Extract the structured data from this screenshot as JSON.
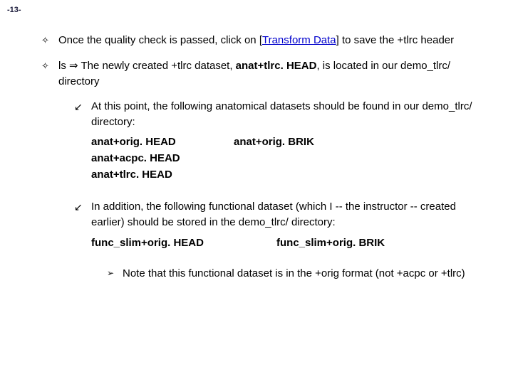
{
  "page_number": "-13-",
  "bullet1": {
    "pre": "Once the quality check is passed, click on ",
    "link": "Transform Data",
    "post": " to save the +tlrc header"
  },
  "bullet2": {
    "pre": "ls ",
    "arrow": "⇒",
    "mid": " The newly created +tlrc dataset, ",
    "bold": "anat+tlrc. HEAD",
    "post": ", is located in our demo_tlrc/ directory"
  },
  "sub1": "At this point, the following anatomical datasets should be found in our demo_tlrc/ directory:",
  "files": {
    "r1c1": "anat+orig. HEAD",
    "r1c2": "anat+orig. BRIK",
    "r2c1": "anat+acpc. HEAD",
    "r3c1": "anat+tlrc. HEAD"
  },
  "sub2": "In addition, the following functional dataset (which I -- the instructor -- created earlier) should be stored in the demo_tlrc/ directory:",
  "files2": {
    "c1": "func_slim+orig. HEAD",
    "c2": "func_slim+orig. BRIK"
  },
  "note": "Note that this functional dataset is in the +orig format (not +acpc or +tlrc)"
}
